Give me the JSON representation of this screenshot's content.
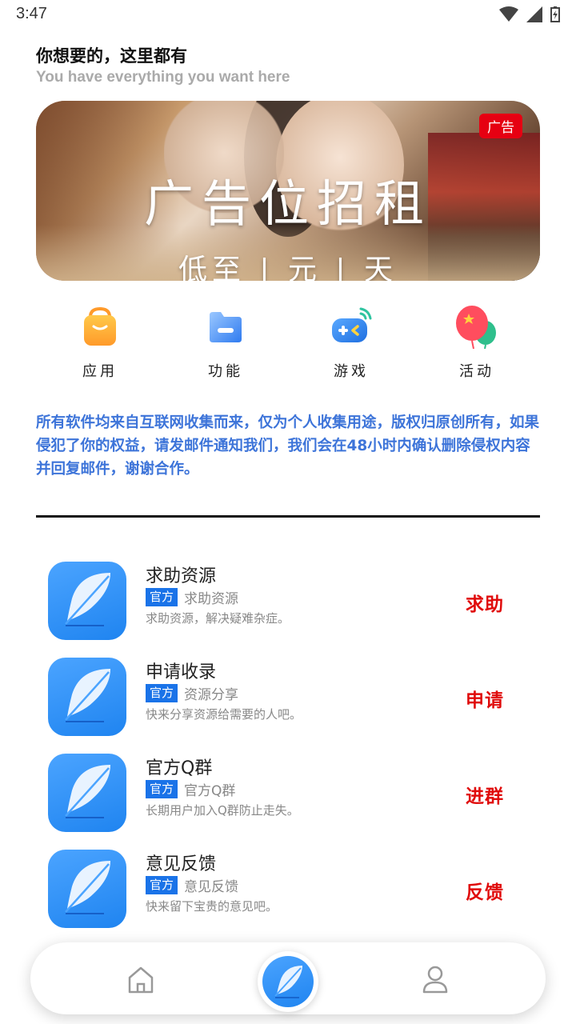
{
  "status_bar": {
    "time": "3:47"
  },
  "header": {
    "title": "你想要的，这里都有",
    "subtitle": "You have everything you want here"
  },
  "banner": {
    "title": "广告位招租",
    "subtitle": "低至 | 元 | 天",
    "badge": "广告"
  },
  "quick_nav": [
    {
      "label": "应用",
      "icon": "shopping-bag-icon"
    },
    {
      "label": "功能",
      "icon": "folder-icon"
    },
    {
      "label": "游戏",
      "icon": "gamepad-icon"
    },
    {
      "label": "活动",
      "icon": "balloon-icon"
    }
  ],
  "notice": "所有软件均来自互联网收集而来，仅为个人收集用途，版权归原创所有，如果侵犯了你的权益，请发邮件通知我们，我们会在48小时内确认删除侵权内容并回复邮件，谢谢合作。",
  "list": [
    {
      "title": "求助资源",
      "tag": "官方",
      "category": "求助资源",
      "desc": "求助资源，解决疑难杂症。",
      "action": "求助"
    },
    {
      "title": "申请收录",
      "tag": "官方",
      "category": "资源分享",
      "desc": "快来分享资源给需要的人吧。",
      "action": "申请"
    },
    {
      "title": "官方Q群",
      "tag": "官方",
      "category": "官方Q群",
      "desc": "长期用户加入Q群防止走失。",
      "action": "进群"
    },
    {
      "title": "意见反馈",
      "tag": "官方",
      "category": "意见反馈",
      "desc": "快来留下宝贵的意见吧。",
      "action": "反馈"
    }
  ],
  "bottom_nav": {
    "items": [
      {
        "icon": "home-icon"
      },
      {
        "icon": "feather-icon"
      },
      {
        "icon": "user-icon"
      }
    ]
  },
  "colors": {
    "accent_blue": "#1f84f0",
    "notice_blue": "#3d74d9",
    "action_red": "#e00b0b",
    "ad_red": "#e60012"
  }
}
